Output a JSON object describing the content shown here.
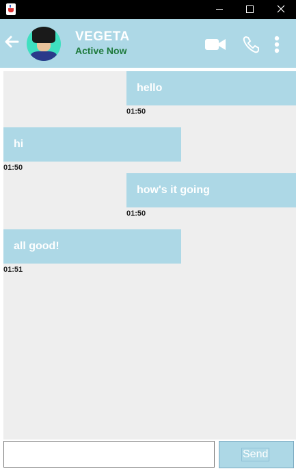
{
  "window": {},
  "header": {
    "contact_name": "VEGETA",
    "status": "Active Now"
  },
  "messages": [
    {
      "text": "hello",
      "time": "01:50",
      "side": "sent"
    },
    {
      "text": "hi",
      "time": "01:50",
      "side": "received"
    },
    {
      "text": "how's it going",
      "time": "01:50",
      "side": "sent"
    },
    {
      "text": "all good!",
      "time": "01:51",
      "side": "received"
    }
  ],
  "composer": {
    "input_value": "",
    "send_label": "Send"
  },
  "colors": {
    "header_bg": "#add8e6",
    "bubble_bg": "#add8e6",
    "status_text": "#1e7a3c",
    "chat_bg": "#eeeeee"
  },
  "icons": [
    "java-app-icon",
    "minimize-icon",
    "maximize-icon",
    "close-icon",
    "back-arrow-icon",
    "video-call-icon",
    "phone-icon",
    "more-options-icon"
  ]
}
